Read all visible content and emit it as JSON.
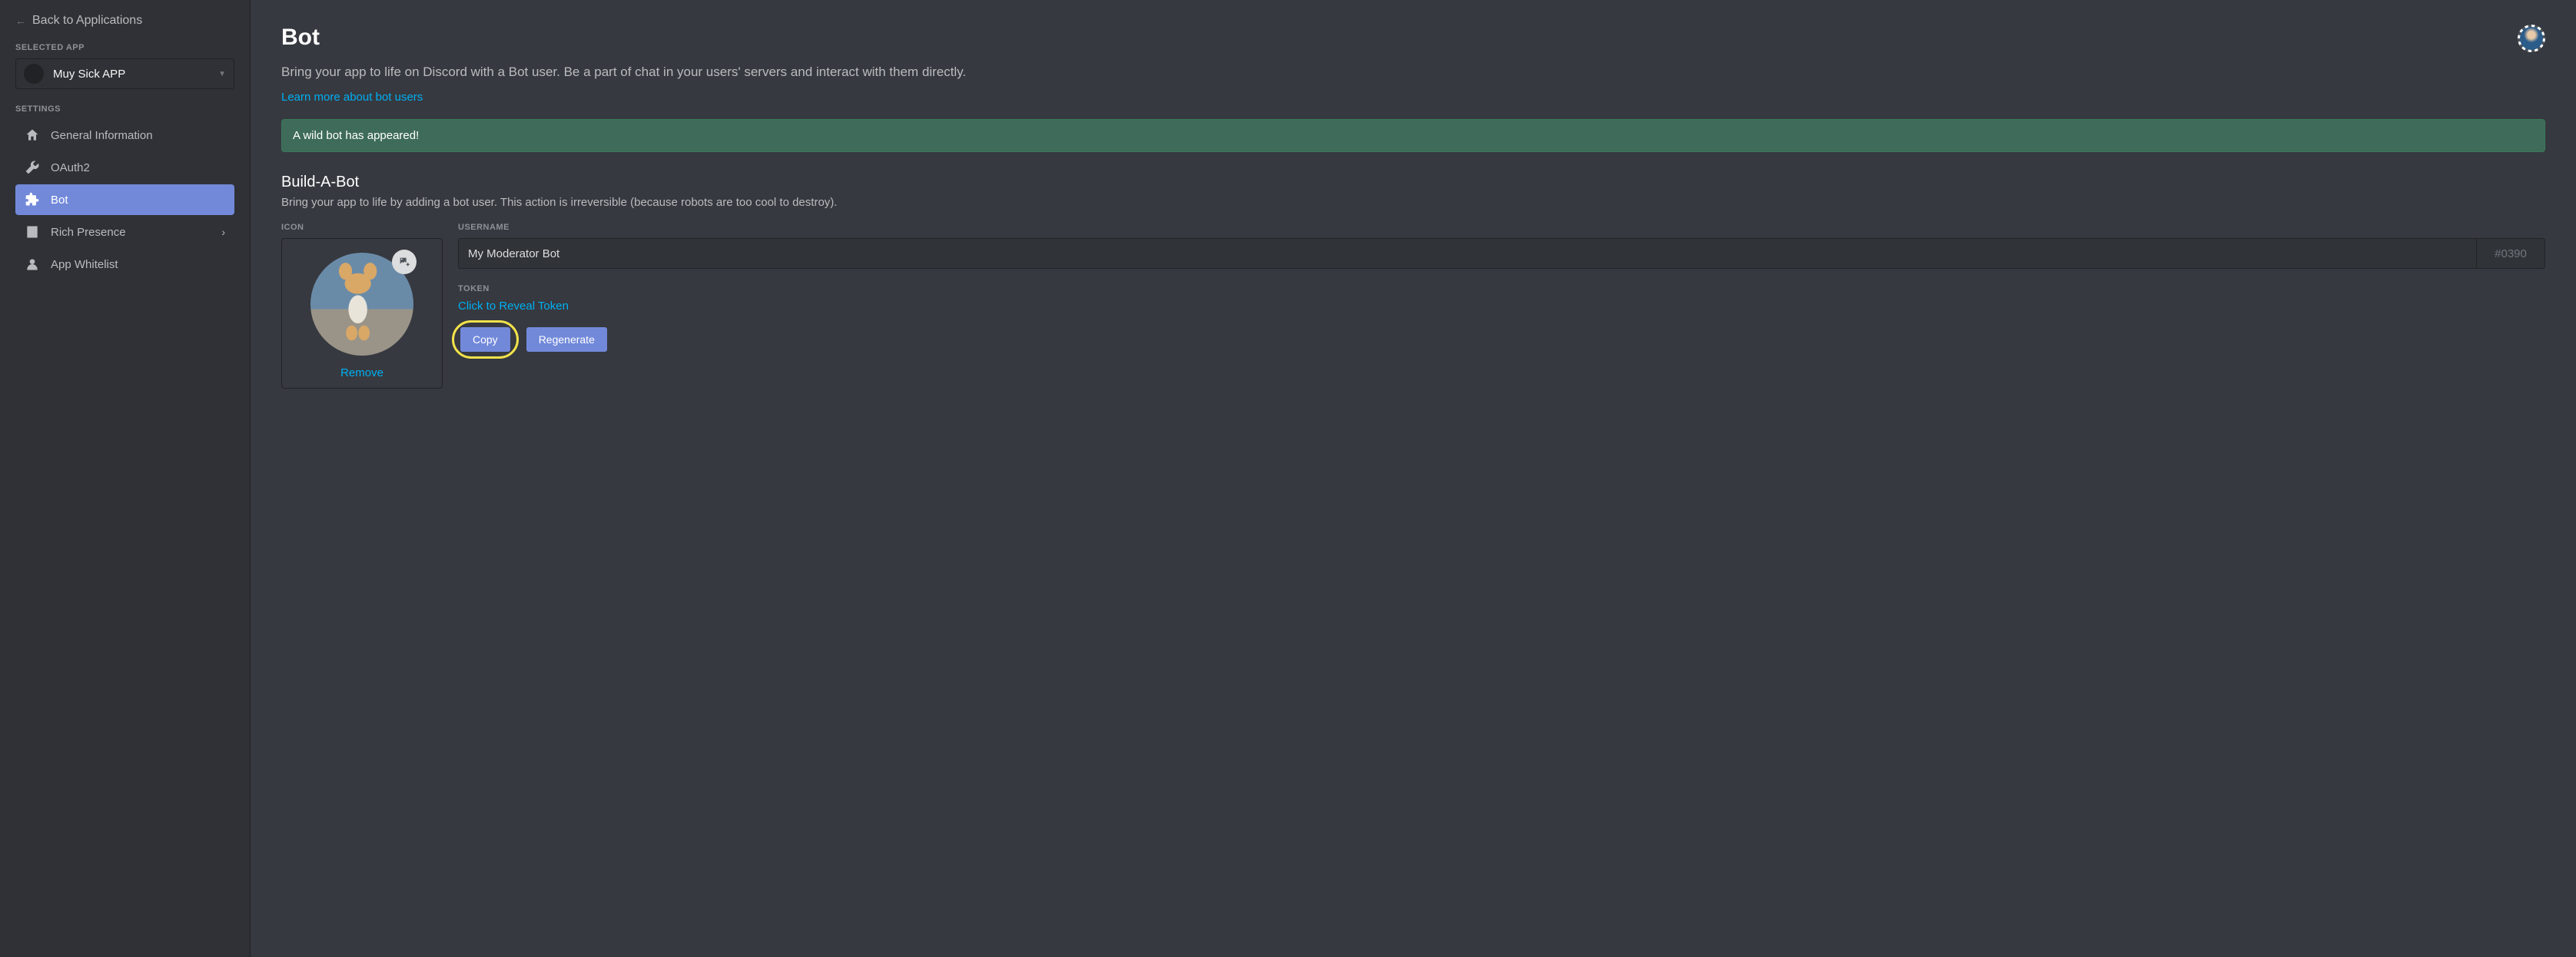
{
  "sidebar": {
    "back_label": "Back to Applications",
    "selected_app_label": "SELECTED APP",
    "selected_app_name": "Muy Sick APP",
    "settings_label": "SETTINGS",
    "items": [
      {
        "label": "General Information"
      },
      {
        "label": "OAuth2"
      },
      {
        "label": "Bot"
      },
      {
        "label": "Rich Presence"
      },
      {
        "label": "App Whitelist"
      }
    ]
  },
  "page": {
    "title": "Bot",
    "description": "Bring your app to life on Discord with a Bot user. Be a part of chat in your users' servers and interact with them directly.",
    "learn_more": "Learn more about bot users",
    "banner": "A wild bot has appeared!"
  },
  "build": {
    "title": "Build-A-Bot",
    "description": "Bring your app to life by adding a bot user. This action is irreversible (because robots are too cool to destroy).",
    "icon_label": "ICON",
    "remove_label": "Remove",
    "username_label": "USERNAME",
    "username_value": "My Moderator Bot",
    "discriminator": "#0390",
    "token_label": "TOKEN",
    "token_reveal": "Click to Reveal Token",
    "copy_label": "Copy",
    "regenerate_label": "Regenerate"
  }
}
